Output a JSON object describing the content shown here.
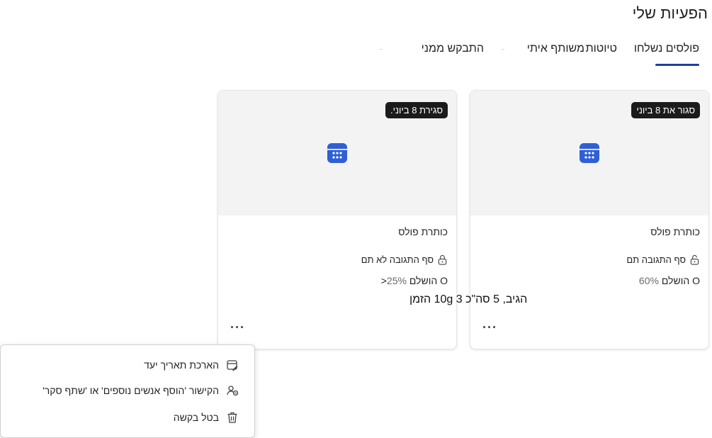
{
  "page": {
    "title": "הפעיות שלי"
  },
  "tabs": [
    {
      "label": "פולסים נשלחו",
      "selected": true
    },
    {
      "label": "טיוטות"
    },
    {
      "label": "משותף איתי"
    },
    {
      "label": "התבקש ממני"
    }
  ],
  "cards": [
    {
      "badge": "סגור את 8 ביוני",
      "title": "כותרת פולס",
      "lock_text": "סף התגובה תם",
      "percent": "60%",
      "percent_prefix": "",
      "status": "O הושלם"
    },
    {
      "badge": "סגירת 8 ביוני.",
      "title": "כותרת פולס",
      "lock_text": "סף התגובה לא תם",
      "percent": "25%",
      "percent_prefix": "<",
      "status": "O הושלם"
    }
  ],
  "overlay_text": "הגיב, 5 סה\"כ 3 10g הזמן",
  "context_menu": {
    "items": [
      {
        "label": "הארכת תאריך יעד",
        "icon": "calendar-edit-icon"
      },
      {
        "label": "הקישור 'הוסף אנשים נוספים' או 'שתף סקר'",
        "icon": "people-link-icon"
      },
      {
        "label": "בטל בקשה",
        "icon": "trash-icon"
      }
    ]
  },
  "colors": {
    "accent": "#1f3f9e",
    "calendar_icon": "#2f5fd3",
    "badge_bg": "#1b1b1b",
    "hero_bg": "#f3f3f3"
  }
}
